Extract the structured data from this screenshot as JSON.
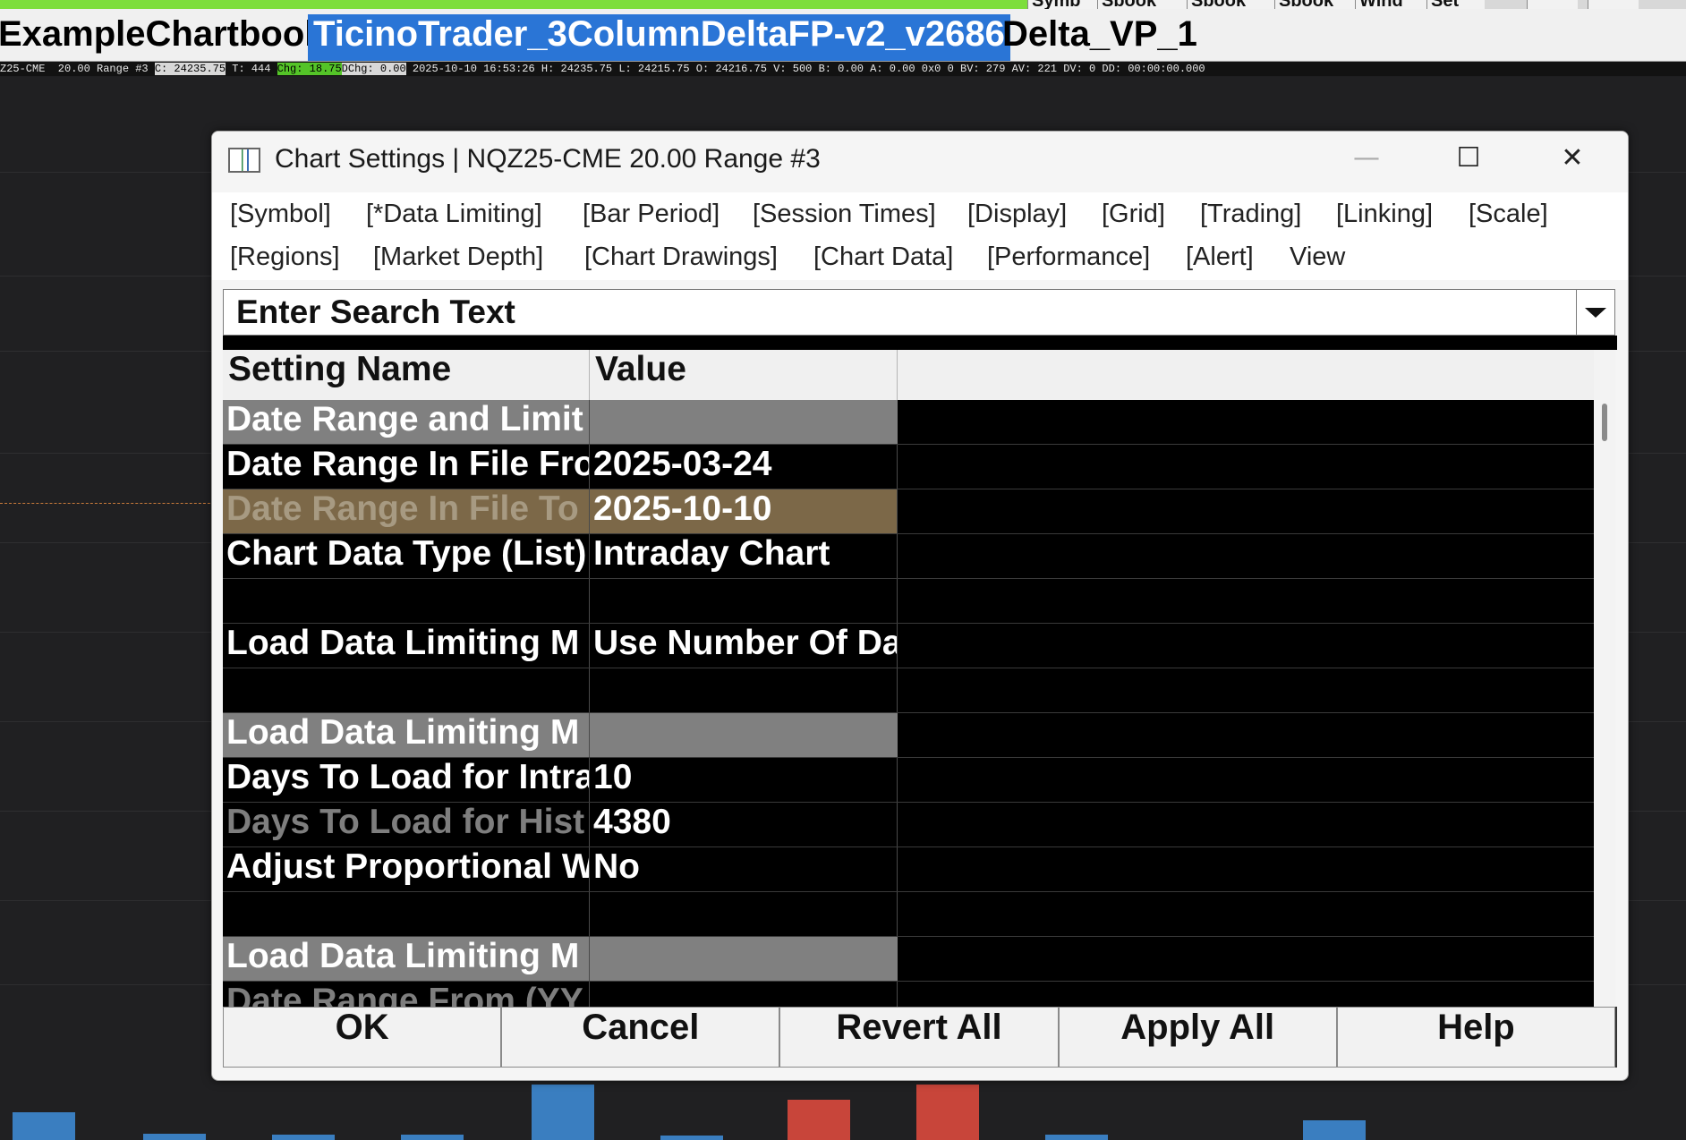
{
  "topbar": {
    "buttons": [
      "Symb",
      "Sbook",
      "Sbook",
      "Sbook",
      "Wind",
      "Set"
    ]
  },
  "tabs": [
    {
      "label": "ExampleChartbook",
      "active": false
    },
    {
      "label": "TicinoTrader_3ColumnDeltaFP-v2_v2686",
      "active": true
    },
    {
      "label": "Delta_VP_1",
      "active": false
    }
  ],
  "infoline": {
    "symbol_period": "Z25-CME  20.00 Range #3 ",
    "close": "C: 24235.75",
    "trades": " T: 444 ",
    "change": "Chg: 18.75",
    "dchange": "DChg: 0.00",
    "rest": " 2025-10-10 16:53:26 H: 24235.75 L: 24215.75 O: 24216.75 V: 500 B: 0.00 A: 0.00 0x0 0 BV: 279 AV: 221 DV: 0 DD: 00:00:00.000"
  },
  "chart_bars": [
    {
      "color": "#3a7ec0",
      "height": 0.5
    },
    {
      "color": "#3a7ec0",
      "height": 0.12
    },
    {
      "color": "#3a7ec0",
      "height": 0.1
    },
    {
      "color": "#3a7ec0",
      "height": 0.1
    },
    {
      "color": "#3a7ec0",
      "height": 1.0
    },
    {
      "color": "#3a7ec0",
      "height": 0.08
    },
    {
      "color": "#c8453a",
      "height": 0.72
    },
    {
      "color": "#c8453a",
      "height": 1.0
    },
    {
      "color": "#3a7ec0",
      "height": 0.1
    },
    {
      "color": "#3a7ec0",
      "height": 0.35
    }
  ],
  "dialog": {
    "title": "Chart Settings | NQZ25-CME  20.00 Range #3",
    "menu_row1": [
      "[Symbol]",
      "[*Data Limiting]",
      "[Bar Period]",
      "[Session Times]",
      "[Display]",
      "[Grid]",
      "[Trading]",
      "[Linking]",
      "[Scale]"
    ],
    "menu_row2": [
      "[Regions]",
      "[Market Depth]",
      "[Chart Drawings]",
      "[Chart Data]",
      "[Performance]",
      "[Alert]",
      "View"
    ],
    "search_text": "Enter Search Text",
    "columns": {
      "name": "Setting Name",
      "value": "Value"
    },
    "rows": [
      {
        "name": "Date Range and Limit",
        "value": "",
        "type": "header"
      },
      {
        "name": "Date Range In File From",
        "value": "2025-03-24",
        "type": "normal"
      },
      {
        "name": "Date Range In File To",
        "value": "2025-10-10",
        "type": "selected"
      },
      {
        "name": "Chart Data Type (List)",
        "value": "Intraday Chart",
        "type": "normal"
      },
      {
        "name": "",
        "value": "",
        "type": "blank"
      },
      {
        "name": "Load Data Limiting M",
        "value": "Use Number Of Da",
        "type": "normal"
      },
      {
        "name": "",
        "value": "",
        "type": "blank"
      },
      {
        "name": "Load Data Limiting M",
        "value": "",
        "type": "header"
      },
      {
        "name": "Days To Load for Intra",
        "value": "10",
        "type": "normal"
      },
      {
        "name": "Days To Load for Hist",
        "value": "4380",
        "type": "dim"
      },
      {
        "name": "Adjust Proportional W",
        "value": "No",
        "type": "normal"
      },
      {
        "name": "",
        "value": "",
        "type": "blank"
      },
      {
        "name": "Load Data Limiting M",
        "value": "",
        "type": "header"
      },
      {
        "name": "Date Range From (YY",
        "value": "",
        "type": "dim"
      }
    ],
    "buttons": {
      "ok": "OK",
      "cancel": "Cancel",
      "revert": "Revert All",
      "apply": "Apply All",
      "help": "Help"
    }
  }
}
